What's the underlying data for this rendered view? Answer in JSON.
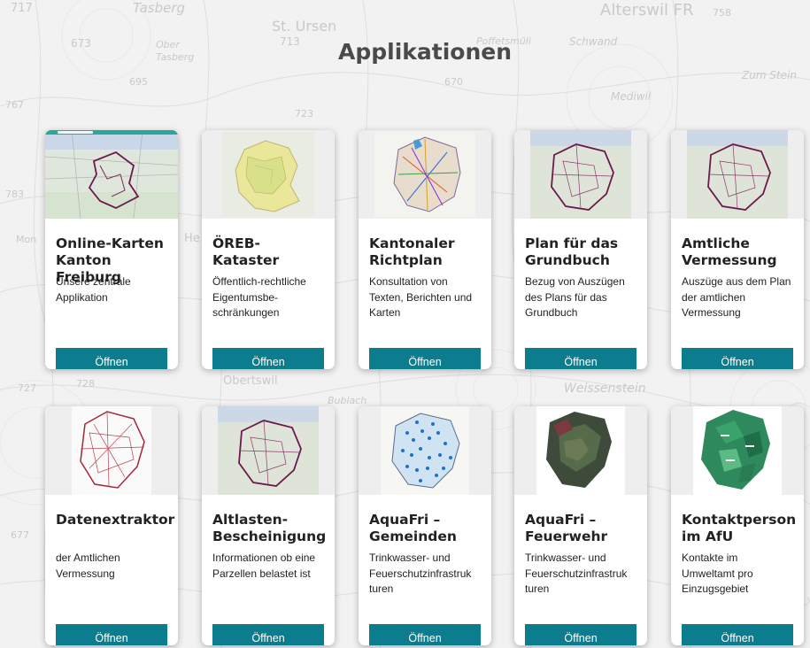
{
  "page": {
    "title": "Applikationen"
  },
  "map_labels": [
    "717",
    "Tasberg",
    "St. Ursen",
    "713",
    "Poffetsmüli",
    "Schwand",
    "Alterswil FR",
    "758",
    "673",
    "Ober",
    "Tasberg",
    "695",
    "670",
    "Mediwil",
    "Zum Stein",
    "767",
    "723",
    "783",
    "Mon",
    "He",
    "728",
    "727",
    "Obertswil",
    "Weissenstein",
    "677",
    "Bublach"
  ],
  "button_label": "Öffnen",
  "colors": {
    "button": "#0b7d8f",
    "active_tab": "#2aa69a",
    "title": "#4a4a4a"
  },
  "cards": [
    {
      "title": "Online-Karten Kanton Freiburg",
      "desc": "Unsere zentrale Applikation",
      "thumb_icon": "canton-overview-map"
    },
    {
      "title": "ÖREB-Kataster",
      "desc": "Öffentlich-rechtliche Eigentumsbe-schränkungen",
      "thumb_icon": "oereb-cadastre-map"
    },
    {
      "title": "Kantonaler Richtplan",
      "desc": "Konsultation von Texten, Berichten und Karten",
      "thumb_icon": "master-plan-map"
    },
    {
      "title": "Plan für das Grundbuch",
      "desc": "Bezug von Auszügen des Plans für das Grundbuch",
      "thumb_icon": "land-register-map"
    },
    {
      "title": "Amtliche Vermessung",
      "desc": "Auszüge aus dem Plan der amtlichen Vermessung",
      "thumb_icon": "survey-map"
    },
    {
      "title": "Datenextraktor",
      "desc": "der Amtlichen Vermessung",
      "thumb_icon": "municipality-boundaries-map"
    },
    {
      "title": "Altlasten-Bescheinigung",
      "desc": "Informationen ob eine Parzellen belastet ist",
      "thumb_icon": "contaminated-sites-map"
    },
    {
      "title": "AquaFri – Gemeinden",
      "desc": "Trinkwasser- und Feuerschutzinfrastruk turen",
      "thumb_icon": "water-points-map"
    },
    {
      "title": "AquaFri – Feuerwehr",
      "desc": "Trinkwasser- und Feuerschutzinfrastruk turen",
      "thumb_icon": "aerial-photo-map"
    },
    {
      "title": "Kontaktperson im AfU",
      "desc": "Kontakte im Umweltamt pro Einzugsgebiet",
      "thumb_icon": "catchment-areas-map"
    }
  ]
}
